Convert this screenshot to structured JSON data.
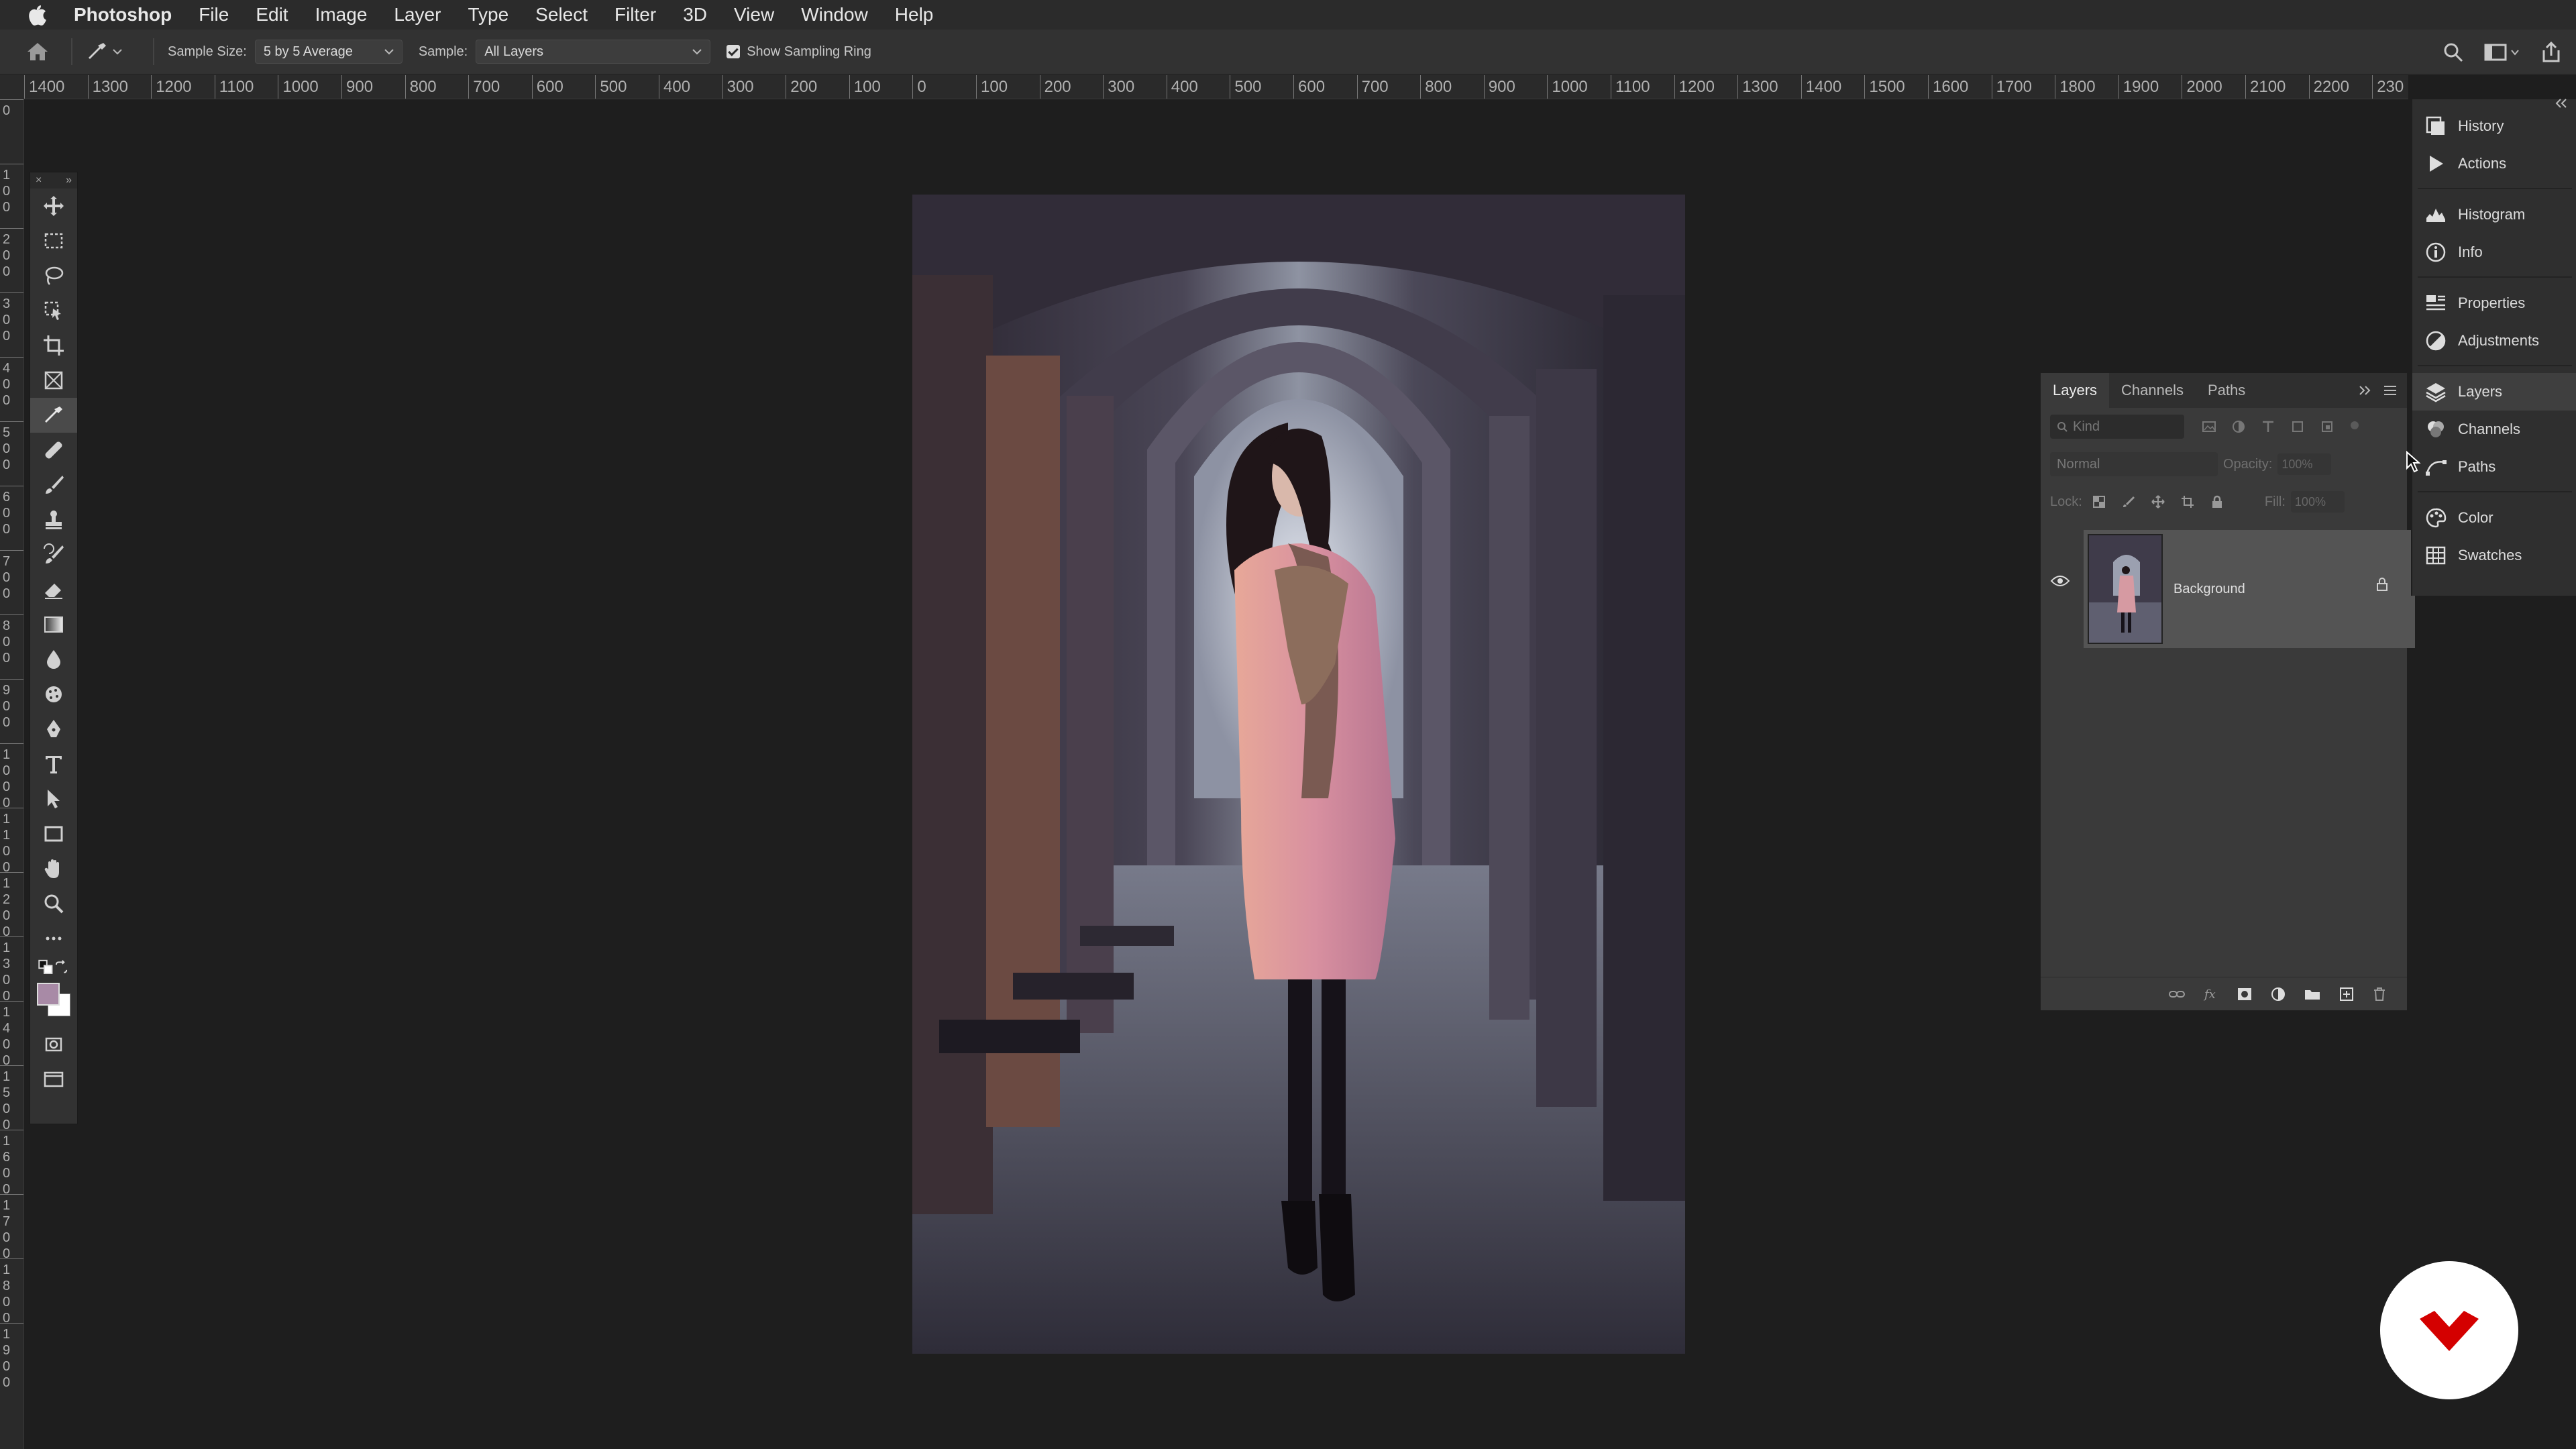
{
  "menubar": {
    "items": [
      "Photoshop",
      "File",
      "Edit",
      "Image",
      "Layer",
      "Type",
      "Select",
      "Filter",
      "3D",
      "View",
      "Window",
      "Help"
    ]
  },
  "options": {
    "sample_size_label": "Sample Size:",
    "sample_size_value": "5 by 5 Average",
    "sample_label": "Sample:",
    "sample_value": "All Layers",
    "sampling_ring_label": "Show Sampling Ring",
    "sampling_ring_checked": true
  },
  "ruler": {
    "h_labels": [
      "1400",
      "1300",
      "1200",
      "1100",
      "1000",
      "900",
      "800",
      "700",
      "600",
      "500",
      "400",
      "300",
      "200",
      "100",
      "0",
      "100",
      "200",
      "300",
      "400",
      "500",
      "600",
      "700",
      "800",
      "900",
      "1000",
      "1100",
      "1200",
      "1300",
      "1400",
      "1500",
      "1600",
      "1700",
      "1800",
      "1900",
      "2000",
      "2100",
      "2200",
      "230"
    ],
    "v_labels": [
      "0",
      "100",
      "200",
      "300",
      "400",
      "500",
      "600",
      "700",
      "800",
      "900",
      "1000",
      "1100",
      "1200",
      "1300",
      "1400",
      "1500",
      "1600",
      "1700",
      "1800",
      "1900"
    ]
  },
  "layers_panel": {
    "tabs": [
      "Layers",
      "Channels",
      "Paths"
    ],
    "kind_placeholder": "Kind",
    "blend_mode": "Normal",
    "opacity_label": "Opacity:",
    "opacity_value": "100%",
    "lock_label": "Lock:",
    "fill_label": "Fill:",
    "fill_value": "100%",
    "layers": [
      {
        "name": "Background",
        "locked": true,
        "visible": true
      }
    ]
  },
  "dock": {
    "items": [
      {
        "label": "History",
        "icon": "history-icon"
      },
      {
        "label": "Actions",
        "icon": "play-icon"
      },
      {
        "label": "Histogram",
        "icon": "histogram-icon"
      },
      {
        "label": "Info",
        "icon": "info-icon"
      },
      {
        "label": "Properties",
        "icon": "properties-icon"
      },
      {
        "label": "Adjustments",
        "icon": "adjustments-icon"
      },
      {
        "label": "Layers",
        "icon": "layers-icon"
      },
      {
        "label": "Channels",
        "icon": "channels-icon"
      },
      {
        "label": "Paths",
        "icon": "paths-icon"
      },
      {
        "label": "Color",
        "icon": "palette-icon"
      },
      {
        "label": "Swatches",
        "icon": "grid-icon"
      }
    ]
  },
  "colors": {
    "foreground": "#a88aa6",
    "background": "#ffffff",
    "accent_logo": "#d40000"
  }
}
